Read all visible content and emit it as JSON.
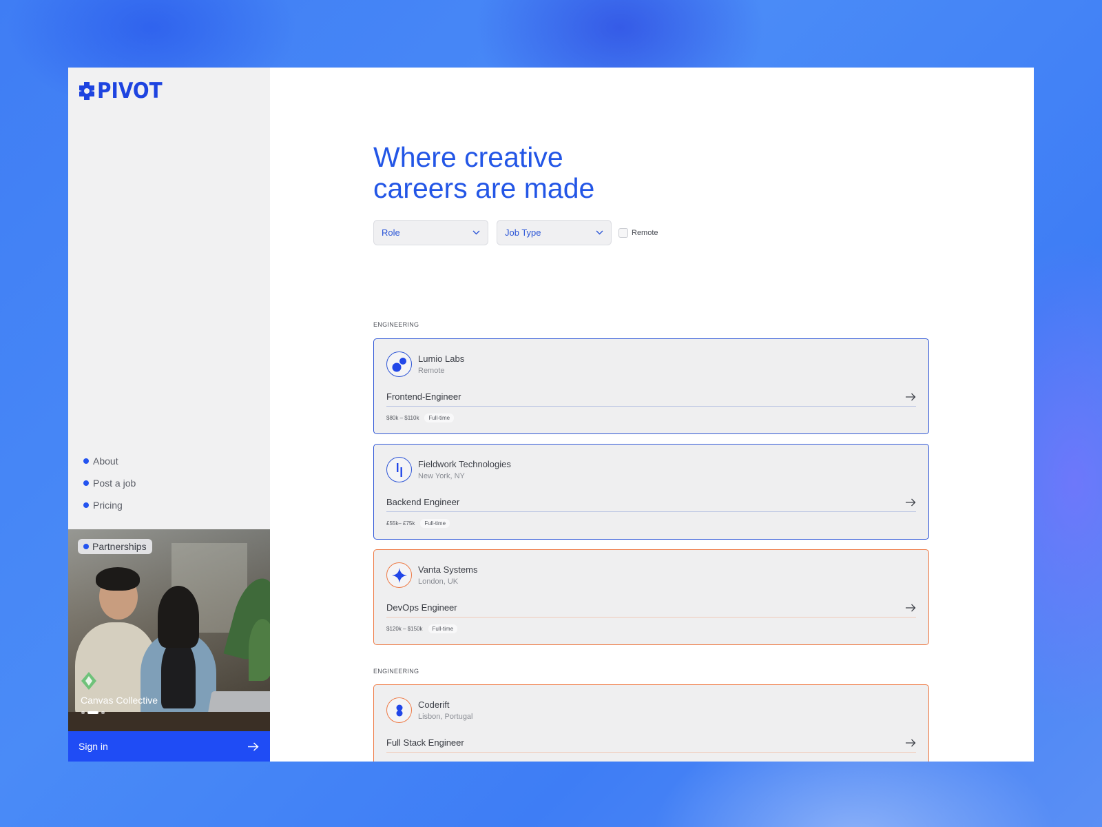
{
  "brand": {
    "name": "PIVOT"
  },
  "nav": {
    "items": [
      {
        "label": "About"
      },
      {
        "label": "Post a job"
      },
      {
        "label": "Pricing"
      }
    ]
  },
  "promo": {
    "badge": "Partnerships",
    "title": "Canvas Collective",
    "slides": 3,
    "active_slide": 2
  },
  "signin": {
    "label": "Sign in"
  },
  "hero": {
    "line1": "Where creative",
    "line2": "careers are made"
  },
  "filters": {
    "role": "Role",
    "job_type": "Job Type",
    "remote_label": "Remote",
    "remote_checked": false
  },
  "sections": [
    {
      "label": "ENGINEERING",
      "jobs": [
        {
          "company": "Lumio Labs",
          "location": "Remote",
          "role": "Frontend-Engineer",
          "salary": "$80k – $110k",
          "type": "Full-time",
          "accent": "blue",
          "icon": "two-dots-icon"
        },
        {
          "company": "Fieldwork Technologies",
          "location": "New York, NY",
          "role": "Backend Engineer",
          "salary": "£55k– £75k",
          "type": "Full-time",
          "accent": "blue",
          "icon": "bars-icon"
        },
        {
          "company": "Vanta Systems",
          "location": "London, UK",
          "role": "DevOps Engineer",
          "salary": "$120k – $150k",
          "type": "Full-time",
          "accent": "orange",
          "icon": "sparkle-icon"
        }
      ]
    },
    {
      "label": "ENGINEERING",
      "jobs": [
        {
          "company": "Coderift",
          "location": "Lisbon, Portugal",
          "role": "Full Stack Engineer",
          "accent": "orange",
          "icon": "stacked-dots-icon"
        }
      ]
    }
  ],
  "colors": {
    "brand_blue": "#1f4cf5",
    "headline_blue": "#2356e6",
    "card_border_blue": "#2d55d6",
    "card_border_orange": "#ee7a45"
  }
}
